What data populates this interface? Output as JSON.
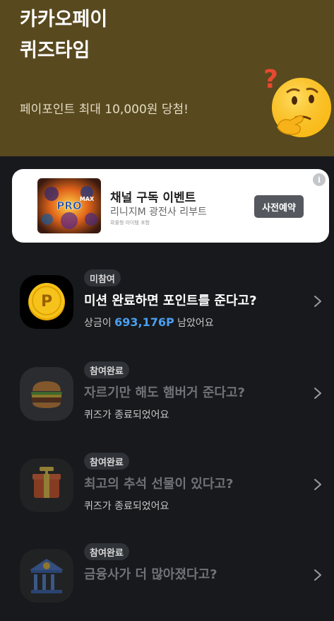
{
  "hero": {
    "title_line1": "카카오페이",
    "title_line2": "퀴즈타임",
    "subtitle": "페이포인트 최대 10,000원 당첨!",
    "bg_color": "#58491f"
  },
  "ad": {
    "title": "채널 구독 이벤트",
    "subtitle": "리니지M 광전사 리부트",
    "note": "확률형 아이템 포함",
    "button_label": "사전예약",
    "info_icon": "i",
    "thumb_text": "PRO",
    "thumb_text2": "MAX"
  },
  "quizzes": [
    {
      "badge": "미참여",
      "title": "미션 완료하면 포인트를 준다고?",
      "sub_prefix": "상금이 ",
      "sub_amount": "693,176P",
      "sub_suffix": " 남았어요",
      "icon": "point-coin-icon",
      "coin_letter": "P"
    },
    {
      "badge": "참여완료",
      "title": "자르기만 해도 햄버거 준다고?",
      "sub": "퀴즈가 종료되었어요",
      "icon": "hamburger-icon"
    },
    {
      "badge": "참여완료",
      "title": "최고의 추석 선물이 있다고?",
      "sub": "퀴즈가 종료되었어요",
      "icon": "gift-box-icon"
    },
    {
      "badge": "참여완료",
      "title": "금융사가 더 많아졌다고?",
      "icon": "bank-icon"
    }
  ],
  "colors": {
    "accent_blue": "#4aa0f0",
    "coin_yellow": "#f6c21c",
    "background": "#17191c"
  }
}
